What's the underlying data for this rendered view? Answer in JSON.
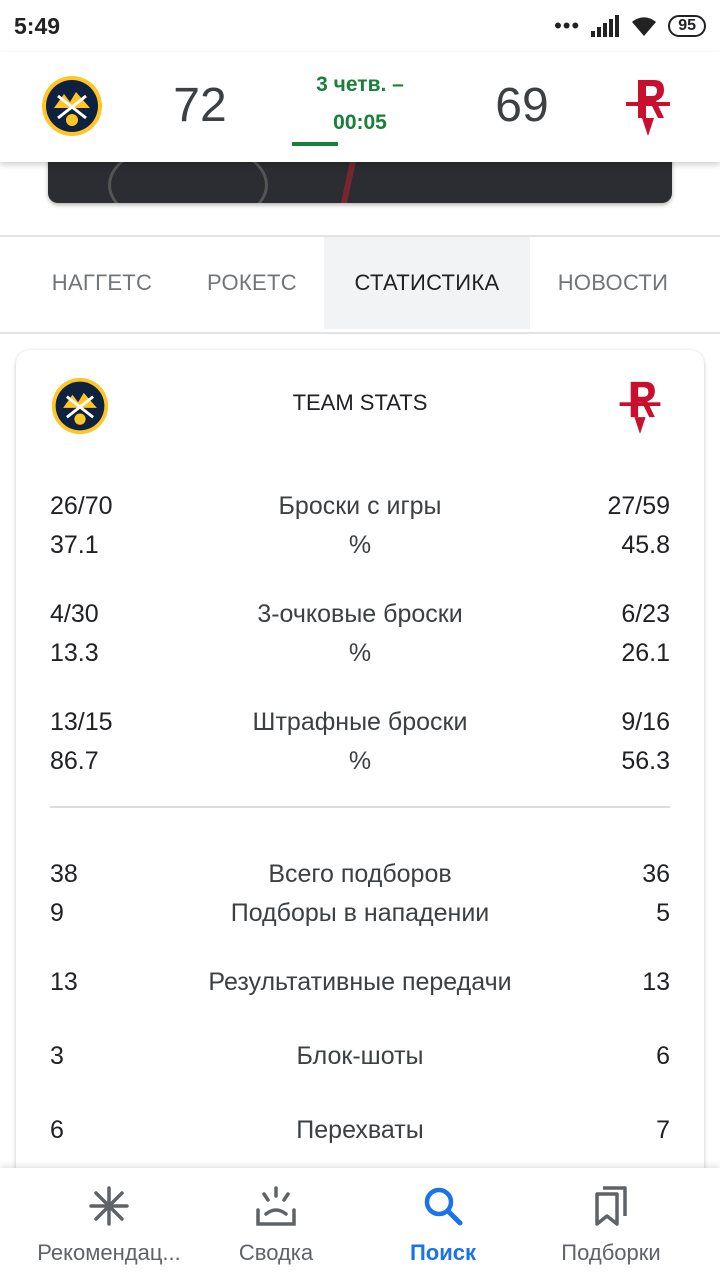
{
  "status_bar": {
    "time": "5:49",
    "battery": "95"
  },
  "game": {
    "home_score": "72",
    "away_score": "69",
    "period": "3 четв. –",
    "clock": "00:05",
    "home_logo": "nuggets-logo",
    "away_logo": "rockets-logo"
  },
  "tabs": [
    {
      "label": "НАГГЕТС"
    },
    {
      "label": "РОКЕТС"
    },
    {
      "label": "СТАТИСТИКА",
      "active": true
    },
    {
      "label": "НОВОСТИ"
    }
  ],
  "stats": {
    "title": "TEAM STATS",
    "rows": [
      {
        "left": "26/70",
        "label": "Броски с игры",
        "right": "27/59"
      },
      {
        "left": "37.1",
        "label": "%",
        "right": "45.8"
      },
      {
        "left": "4/30",
        "label": "3-очковые броски",
        "right": "6/23"
      },
      {
        "left": "13.3",
        "label": "%",
        "right": "26.1"
      },
      {
        "left": "13/15",
        "label": "Штрафные броски",
        "right": "9/16"
      },
      {
        "left": "86.7",
        "label": "%",
        "right": "56.3"
      },
      {
        "left": "38",
        "label": "Всего подборов",
        "right": "36"
      },
      {
        "left": "9",
        "label": "Подборы в нападении",
        "right": "5"
      },
      {
        "left": "13",
        "label": "Результативные передачи",
        "right": "13"
      },
      {
        "left": "3",
        "label": "Блок-шоты",
        "right": "6"
      },
      {
        "left": "6",
        "label": "Перехваты",
        "right": "7"
      }
    ]
  },
  "bottom_nav": [
    {
      "label": "Рекомендац...",
      "icon": "asterisk-icon"
    },
    {
      "label": "Сводка",
      "icon": "updates-icon"
    },
    {
      "label": "Поиск",
      "icon": "search-icon",
      "active": true
    },
    {
      "label": "Подборки",
      "icon": "collections-icon"
    }
  ],
  "colors": {
    "accent_green": "#188038",
    "accent_blue": "#1a73e8",
    "rockets_red": "#c8102e",
    "nuggets_navy": "#0e2240",
    "nuggets_gold": "#fec524"
  }
}
